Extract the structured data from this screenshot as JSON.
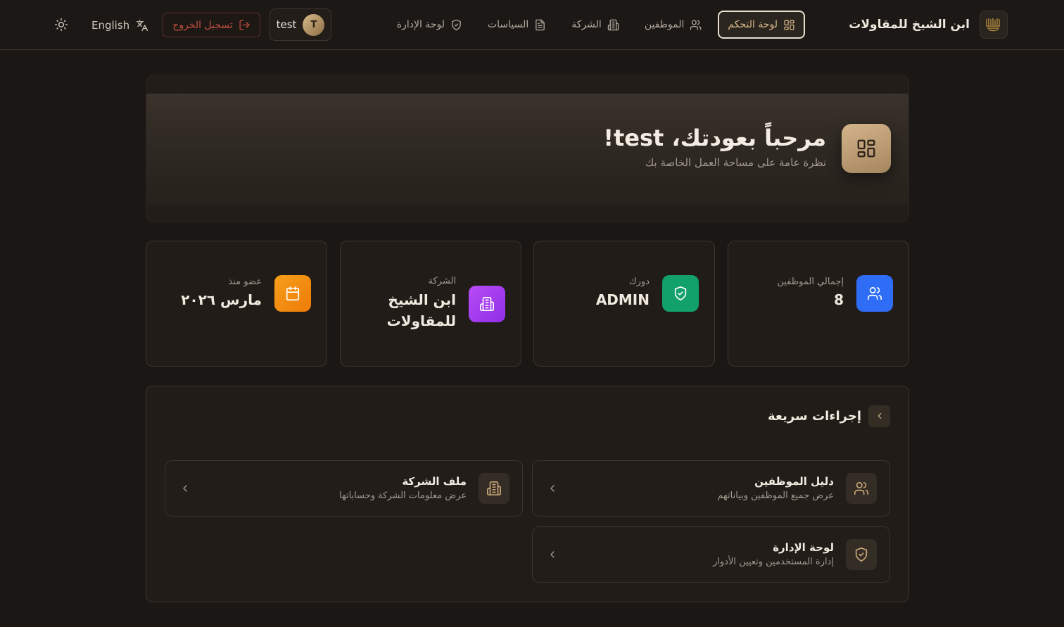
{
  "header": {
    "brand_name": "ابن الشيخ للمقاولات",
    "nav": [
      {
        "label": "لوحة التحكم",
        "icon": "dashboard-icon",
        "active": true
      },
      {
        "label": "الموظفين",
        "icon": "users-icon"
      },
      {
        "label": "الشركة",
        "icon": "building-icon"
      },
      {
        "label": "السياسات",
        "icon": "document-icon"
      },
      {
        "label": "لوحة الإدارة",
        "icon": "shield-check-icon"
      }
    ],
    "user": {
      "name": "test",
      "initial": "T"
    },
    "logout_label": "تسجيل الخروج",
    "language_label": "English",
    "theme_icon": "sun-icon"
  },
  "hero": {
    "title": "مرحباً بعودتك، test!",
    "subtitle": "نظرة عامة على مساحة العمل الخاصة بك"
  },
  "stats": [
    {
      "label": "إجمالي الموظفين",
      "value": "8",
      "icon": "users-icon",
      "color": "#2f6df6"
    },
    {
      "label": "دورك",
      "value": "ADMIN",
      "icon": "shield-check-icon",
      "color": "#12a06b"
    },
    {
      "label": "الشركة",
      "value": "ابن الشيخ للمقاولات",
      "icon": "building-icon",
      "color": "#a23af0"
    },
    {
      "label": "عضو منذ",
      "value": "مارس ٢٠٢٦",
      "icon": "calendar-icon",
      "color": "#f28a0b"
    }
  ],
  "quick_actions": {
    "title": "إجراءات سريعة",
    "items": [
      {
        "title": "دليل الموظفين",
        "subtitle": "عرض جميع الموظفين وبياناتهم",
        "icon": "users-icon"
      },
      {
        "title": "ملف الشركة",
        "subtitle": "عرض معلومات الشركة وحساباتها",
        "icon": "building-icon"
      },
      {
        "title": "لوحة الإدارة",
        "subtitle": "إدارة المستخدمين وتعيين الأدوار",
        "icon": "shield-check-icon"
      }
    ]
  },
  "colors": {
    "accent": "#d9b88b",
    "danger": "#c4503f",
    "background": "#1b1714"
  }
}
